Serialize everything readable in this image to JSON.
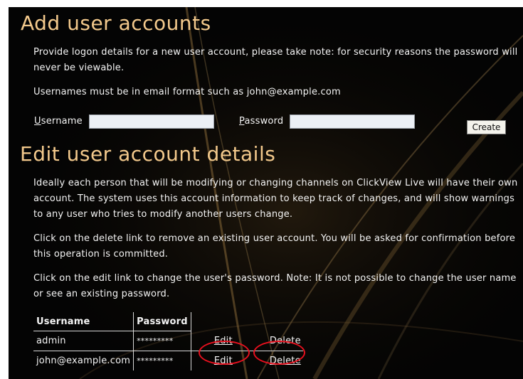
{
  "add_section": {
    "title": "Add user accounts",
    "intro": "Provide logon details for a new user account, please take note: for security reasons the password will never be viewable.",
    "note": "Usernames must be in email format such as john@example.com",
    "username_label_key": "U",
    "username_label_rest": "sername",
    "username_value": "",
    "password_label_key": "P",
    "password_label_rest": "assword",
    "password_value": "",
    "create_label": "Create"
  },
  "edit_section": {
    "title": "Edit user account details",
    "para1": "Ideally each person that will be modifying or changing channels on ClickView Live will have their own account. The system uses this account information to keep track of changes, and will show warnings to any user who tries to modify another users change.",
    "para2": "Click on the delete link to remove an existing user account. You will be asked for confirmation before this operation is committed.",
    "para3": "Click on the edit link to change the user's password. Note: It is not possible to change the user name or see an existing password."
  },
  "users_table": {
    "columns": [
      "Username",
      "Password"
    ],
    "rows": [
      {
        "username": "admin",
        "password": "*********",
        "edit": "Edit",
        "delete": "Delete"
      },
      {
        "username": "john@example.com",
        "password": "*********",
        "edit": "Edit",
        "delete": "Delete"
      }
    ]
  },
  "colors": {
    "background": "#040404",
    "heading": "#f3c98c",
    "highlight_ring": "#e8101e"
  }
}
